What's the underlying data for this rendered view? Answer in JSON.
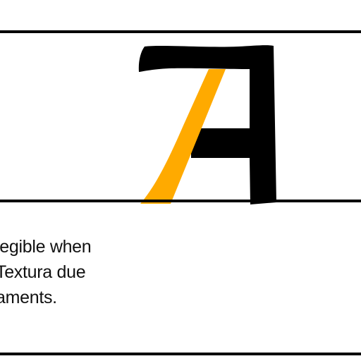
{
  "colors": {
    "background": "#ffffff",
    "rules": "#000000",
    "glyph_main": "#000000",
    "glyph_stroke_highlight": "#ffaa00",
    "text": "#111111"
  },
  "illustration": {
    "glyph_depicted": "A",
    "icon": "letter-a-glyph"
  },
  "caption": {
    "lines": [
      "legible when",
      "Textura due",
      "aments."
    ]
  }
}
